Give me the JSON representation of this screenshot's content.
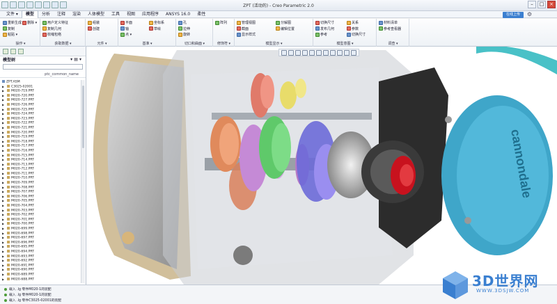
{
  "window": {
    "title": "ZPT (活动的) - Creo Parametric 2.0"
  },
  "menu": {
    "tabs": [
      "文件 ▾",
      "模型",
      "分析",
      "注释",
      "渲染",
      "人体模型",
      "工具",
      "视图",
      "应用程序",
      "ANSYS 16.0",
      "柔性"
    ],
    "active_index": 1,
    "login_label": "在线上传"
  },
  "ribbon": {
    "groups": [
      {
        "label": "操作 ▾",
        "items": [
          "重新生成",
          "复制",
          "粘贴 ▾",
          "删除 ▾"
        ]
      },
      {
        "label": "获取数据 ▾",
        "items": [
          "用户定义特征",
          "复制几何",
          "收缩包络"
        ]
      },
      {
        "label": "元件 ▾",
        "items": [
          "组装",
          "创建"
        ]
      },
      {
        "label": "基准 ▾",
        "items": [
          "平面",
          "轴",
          "点 ▾",
          "坐标系",
          "草绘"
        ]
      },
      {
        "label": "切口和曲面 ▾",
        "items": [
          "孔",
          "拉伸",
          "旋转"
        ]
      },
      {
        "label": "修饰符 ▾",
        "items": [
          "阵列"
        ]
      },
      {
        "label": "模型显示 ▾",
        "items": [
          "管理视图",
          "截面",
          "显示样式",
          "分解图",
          "编辑位置"
        ]
      },
      {
        "label": "模型意图 ▾",
        "items": [
          "切换尺寸",
          "发布几何",
          "参考",
          "关系",
          "参数",
          "切换尺寸"
        ]
      },
      {
        "label": "调查 ▾",
        "items": [
          "材料清单",
          "参考查看器"
        ]
      }
    ]
  },
  "left_panel": {
    "title": "模型树",
    "subheader": "ptc_common_name",
    "tree": [
      "ZPT.ASM",
      "C3025-02001",
      "M020-719.PRT",
      "M020-720.PRT",
      "M020-727.PRT",
      "M020-726.PRT",
      "M020-725.PRT",
      "M020-724.PRT",
      "M020-723.PRT",
      "M020-722.PRT",
      "M020-721.PRT",
      "M020-720.PRT",
      "M020-719.PRT",
      "M020-718.PRT",
      "M020-717.PRT",
      "M020-716.PRT",
      "M020-715.PRT",
      "M020-714.PRT",
      "M020-713.PRT",
      "M020-712.PRT",
      "M020-711.PRT",
      "M020-710.PRT",
      "M020-709.PRT",
      "M020-708.PRT",
      "M020-707.PRT",
      "M020-706.PRT",
      "M020-705.PRT",
      "M020-704.PRT",
      "M020-703.PRT",
      "M020-702.PRT",
      "M020-701.PRT",
      "M020-700.PRT",
      "M020-699.PRT",
      "M020-698.PRT",
      "M020-697.PRT",
      "M020-696.PRT",
      "M020-695.PRT",
      "M020-694.PRT",
      "M020-693.PRT",
      "M020-692.PRT",
      "M020-691.PRT",
      "M020-690.PRT",
      "M020-689.PRT",
      "M020-688.PRT"
    ]
  },
  "viewport": {
    "model_brand": "cannondale"
  },
  "status": {
    "messages": [
      "载入 .lg  零件M020-1的装配",
      "载入 .lg  零件M020-1的装配",
      "载入 .lg  零件C3025-02001的装配"
    ]
  },
  "watermark": {
    "title": "3D世界网",
    "url": "WWW.3DSJW.COM"
  }
}
